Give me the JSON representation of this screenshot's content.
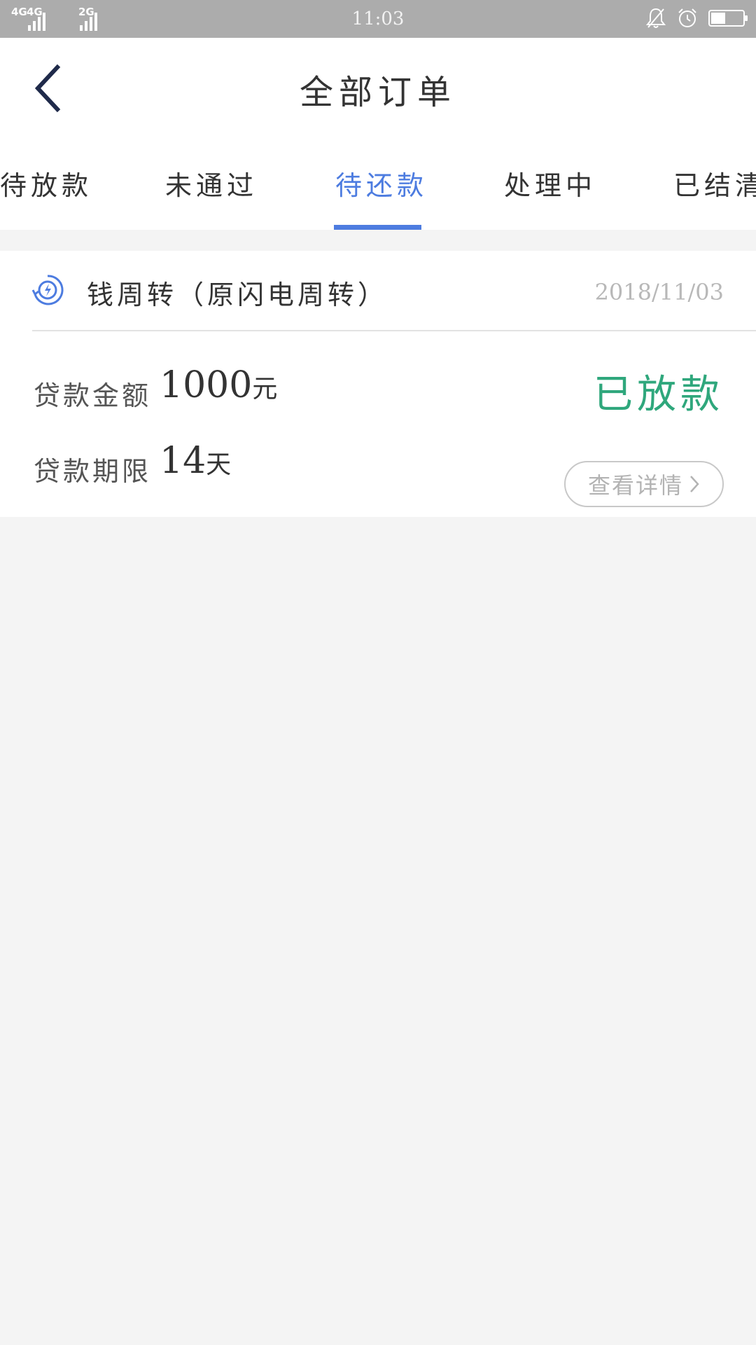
{
  "status_bar": {
    "network_1": "4G",
    "network_2": "4G",
    "network_3": "2G",
    "time": "11:03",
    "icons": [
      "mute-bell-icon",
      "alarm-clock-icon",
      "battery-icon"
    ],
    "battery_level": 0.45
  },
  "header": {
    "title": "全部订单",
    "back_icon": "chevron-left-icon"
  },
  "tabs": [
    {
      "label": "待放款",
      "active": false
    },
    {
      "label": "未通过",
      "active": false
    },
    {
      "label": "待还款",
      "active": true
    },
    {
      "label": "处理中",
      "active": false
    },
    {
      "label": "已结清",
      "active": false
    }
  ],
  "order": {
    "product_name": "钱周转（原闪电周转）",
    "product_icon": "lightning-circle-icon",
    "date": "2018/11/03",
    "amount_label": "贷款金额",
    "amount_value": "1000",
    "amount_unit": "元",
    "term_label": "贷款期限",
    "term_value": "14",
    "term_unit": "天",
    "status": "已放款",
    "detail_button": "查看详情"
  },
  "colors": {
    "accent": "#4d7ce0",
    "status_green": "#2fa77c",
    "status_bar": "#acacac",
    "background": "#f4f4f4"
  }
}
